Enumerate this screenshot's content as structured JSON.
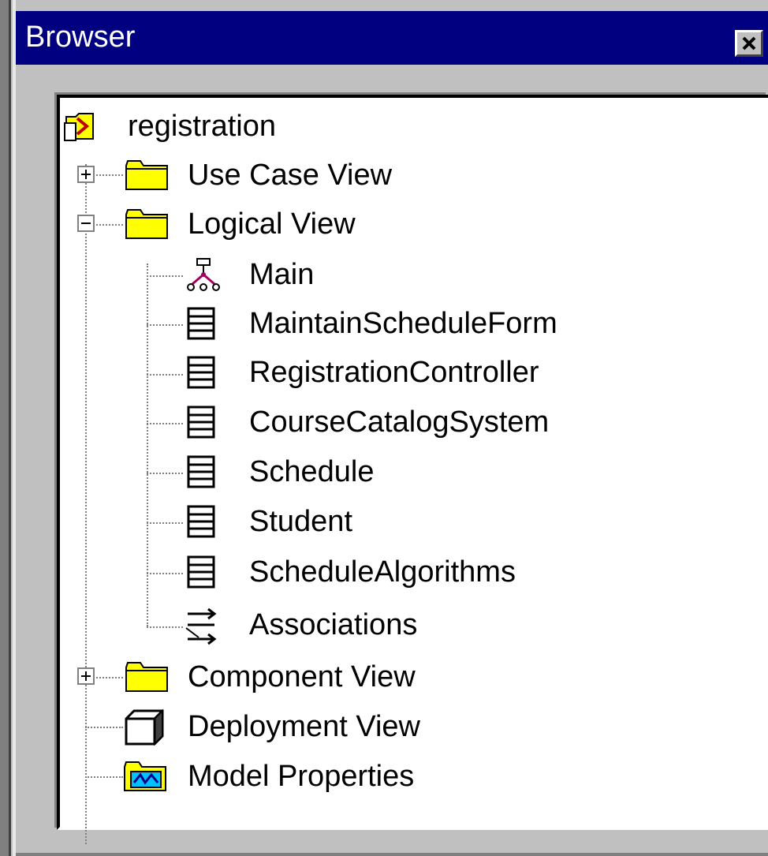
{
  "window": {
    "title": "Browser",
    "close_icon": "close-icon"
  },
  "tree": {
    "root": {
      "label": "registration",
      "icon": "model-root-icon"
    },
    "items": [
      {
        "label": "Use Case View",
        "icon": "folder-icon",
        "expander": "+"
      },
      {
        "label": "Logical View",
        "icon": "folder-icon",
        "expander": "−"
      },
      {
        "label": "Main",
        "icon": "class-diagram-icon"
      },
      {
        "label": "MaintainScheduleForm",
        "icon": "class-icon"
      },
      {
        "label": "RegistrationController",
        "icon": "class-icon"
      },
      {
        "label": "CourseCatalogSystem",
        "icon": "class-icon"
      },
      {
        "label": "Schedule",
        "icon": "class-icon"
      },
      {
        "label": "Student",
        "icon": "class-icon"
      },
      {
        "label": "ScheduleAlgorithms",
        "icon": "class-icon"
      },
      {
        "label": "Associations",
        "icon": "associations-icon"
      },
      {
        "label": "Component View",
        "icon": "folder-icon",
        "expander": "+"
      },
      {
        "label": "Deployment View",
        "icon": "deployment-node-icon"
      },
      {
        "label": "Model Properties",
        "icon": "model-properties-icon"
      }
    ]
  },
  "colors": {
    "titlebar": "#000080",
    "window_face": "#c0c0c0",
    "tree_background": "#ffffff",
    "folder_yellow": "#ffff00"
  }
}
